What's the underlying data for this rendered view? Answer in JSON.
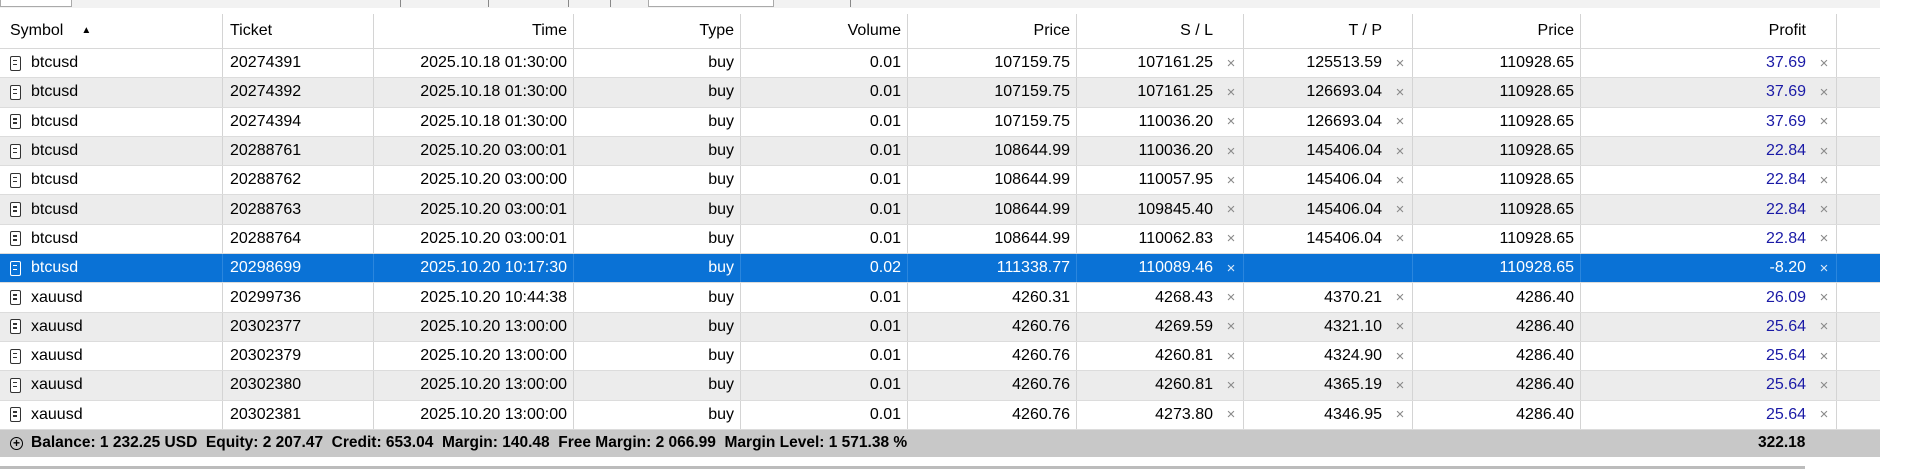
{
  "columns": [
    "Symbol",
    "Ticket",
    "Time",
    "Type",
    "Volume",
    "Price",
    "S / L",
    "T / P",
    "Price",
    "Profit"
  ],
  "rows": [
    {
      "symbol": "btcusd",
      "ticket": "20274391",
      "time": "2025.10.18 01:30:00",
      "type": "buy",
      "volume": "0.01",
      "open_price": "107159.75",
      "sl": "107161.25",
      "tp": "125513.59",
      "price": "110928.65",
      "profit": "37.69"
    },
    {
      "symbol": "btcusd",
      "ticket": "20274392",
      "time": "2025.10.18 01:30:00",
      "type": "buy",
      "volume": "0.01",
      "open_price": "107159.75",
      "sl": "107161.25",
      "tp": "126693.04",
      "price": "110928.65",
      "profit": "37.69"
    },
    {
      "symbol": "btcusd",
      "ticket": "20274394",
      "time": "2025.10.18 01:30:00",
      "type": "buy",
      "volume": "0.01",
      "open_price": "107159.75",
      "sl": "110036.20",
      "tp": "126693.04",
      "price": "110928.65",
      "profit": "37.69"
    },
    {
      "symbol": "btcusd",
      "ticket": "20288761",
      "time": "2025.10.20 03:00:01",
      "type": "buy",
      "volume": "0.01",
      "open_price": "108644.99",
      "sl": "110036.20",
      "tp": "145406.04",
      "price": "110928.65",
      "profit": "22.84"
    },
    {
      "symbol": "btcusd",
      "ticket": "20288762",
      "time": "2025.10.20 03:00:00",
      "type": "buy",
      "volume": "0.01",
      "open_price": "108644.99",
      "sl": "110057.95",
      "tp": "145406.04",
      "price": "110928.65",
      "profit": "22.84"
    },
    {
      "symbol": "btcusd",
      "ticket": "20288763",
      "time": "2025.10.20 03:00:01",
      "type": "buy",
      "volume": "0.01",
      "open_price": "108644.99",
      "sl": "109845.40",
      "tp": "145406.04",
      "price": "110928.65",
      "profit": "22.84"
    },
    {
      "symbol": "btcusd",
      "ticket": "20288764",
      "time": "2025.10.20 03:00:01",
      "type": "buy",
      "volume": "0.01",
      "open_price": "108644.99",
      "sl": "110062.83",
      "tp": "145406.04",
      "price": "110928.65",
      "profit": "22.84"
    },
    {
      "symbol": "btcusd",
      "ticket": "20298699",
      "time": "2025.10.20 10:17:30",
      "type": "buy",
      "volume": "0.02",
      "open_price": "111338.77",
      "sl": "110089.46",
      "tp": "",
      "price": "110928.65",
      "profit": "-8.20",
      "selected": true
    },
    {
      "symbol": "xauusd",
      "ticket": "20299736",
      "time": "2025.10.20 10:44:38",
      "type": "buy",
      "volume": "0.01",
      "open_price": "4260.31",
      "sl": "4268.43",
      "tp": "4370.21",
      "price": "4286.40",
      "profit": "26.09"
    },
    {
      "symbol": "xauusd",
      "ticket": "20302377",
      "time": "2025.10.20 13:00:00",
      "type": "buy",
      "volume": "0.01",
      "open_price": "4260.76",
      "sl": "4269.59",
      "tp": "4321.10",
      "price": "4286.40",
      "profit": "25.64"
    },
    {
      "symbol": "xauusd",
      "ticket": "20302379",
      "time": "2025.10.20 13:00:00",
      "type": "buy",
      "volume": "0.01",
      "open_price": "4260.76",
      "sl": "4260.81",
      "tp": "4324.90",
      "price": "4286.40",
      "profit": "25.64"
    },
    {
      "symbol": "xauusd",
      "ticket": "20302380",
      "time": "2025.10.20 13:00:00",
      "type": "buy",
      "volume": "0.01",
      "open_price": "4260.76",
      "sl": "4260.81",
      "tp": "4365.19",
      "price": "4286.40",
      "profit": "25.64"
    },
    {
      "symbol": "xauusd",
      "ticket": "20302381",
      "time": "2025.10.20 13:00:00",
      "type": "buy",
      "volume": "0.01",
      "open_price": "4260.76",
      "sl": "4273.80",
      "tp": "4346.95",
      "price": "4286.40",
      "profit": "25.64"
    }
  ],
  "summary": {
    "text": "Balance: 1 232.25 USD  Equity: 2 207.47  Credit: 653.04  Margin: 140.48  Free Margin: 2 066.99  Margin Level: 1 571.38 %",
    "total_profit": "322.18"
  },
  "icons": {
    "sort": "sort-ascending-icon",
    "row": "document-icon",
    "close": "close-icon",
    "expand": "expand-plus-icon"
  },
  "colors": {
    "selected_row": "#0a72d6",
    "profit_text": "#1a1aa6",
    "alt_row": "#ececec",
    "summary_bar": "#c8c8c8"
  }
}
